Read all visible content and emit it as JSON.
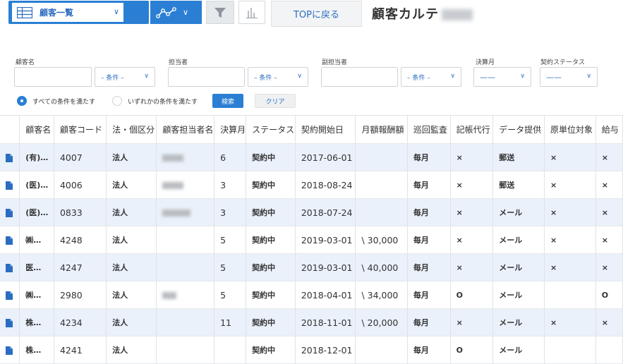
{
  "toolbar": {
    "view_label": "顧客一覧",
    "top_button": "TOPに戻る",
    "page_title": "顧客カルテ"
  },
  "filters": {
    "customer_name_label": "顧客名",
    "staff_label": "担当者",
    "sub_staff_label": "副担当者",
    "settlement_month_label": "決算月",
    "contract_status_label": "契約ステータス",
    "condition_label": "– 条件 –",
    "dash_value": "——",
    "radio_all": "すべての条件を満たす",
    "radio_any": "いずれかの条件を満たす",
    "search_button": "検索",
    "clear_button": "クリア"
  },
  "table": {
    "headers": [
      "",
      "顧客名",
      "顧客コード",
      "法・個区分",
      "顧客担当者名",
      "決算月",
      "ステータス",
      "契約開始日",
      "月額報酬額",
      "巡回監査",
      "記帳代行",
      "データ提供",
      "原単位対象",
      "給与"
    ],
    "rows": [
      {
        "name": "(有)…",
        "code": "4007",
        "type": "法人",
        "month": "6",
        "status": "契約中",
        "start": "2017-06-01",
        "fee": "",
        "audit": "毎月",
        "bookkeeping": "×",
        "data": "郵送",
        "unit": "×",
        "salary": "×"
      },
      {
        "name": "(医)…",
        "code": "4006",
        "type": "法人",
        "month": "3",
        "status": "契約中",
        "start": "2018-08-24",
        "fee": "",
        "audit": "毎月",
        "bookkeeping": "×",
        "data": "郵送",
        "unit": "×",
        "salary": "×"
      },
      {
        "name": "(医)…",
        "code": "0833",
        "type": "法人",
        "month": "3",
        "status": "契約中",
        "start": "2018-07-24",
        "fee": "",
        "audit": "毎月",
        "bookkeeping": "×",
        "data": "メール",
        "unit": "×",
        "salary": "×"
      },
      {
        "name": "㈱…",
        "code": "4248",
        "type": "法人",
        "month": "5",
        "status": "契約中",
        "start": "2019-03-01",
        "fee": "\\ 30,000",
        "audit": "毎月",
        "bookkeeping": "×",
        "data": "メール",
        "unit": "×",
        "salary": "×"
      },
      {
        "name": "医…",
        "code": "4247",
        "type": "法人",
        "month": "5",
        "status": "契約中",
        "start": "2019-03-01",
        "fee": "\\ 40,000",
        "audit": "毎月",
        "bookkeeping": "×",
        "data": "メール",
        "unit": "×",
        "salary": "×"
      },
      {
        "name": "㈱…",
        "code": "2980",
        "type": "法人",
        "month": "5",
        "status": "契約中",
        "start": "2018-04-01",
        "fee": "\\ 34,000",
        "audit": "毎月",
        "bookkeeping": "O",
        "data": "メール",
        "unit": "",
        "salary": "O"
      },
      {
        "name": "株…",
        "code": "4234",
        "type": "法人",
        "month": "11",
        "status": "契約中",
        "start": "2018-11-01",
        "fee": "\\ 20,000",
        "audit": "毎月",
        "bookkeeping": "×",
        "data": "メール",
        "unit": "×",
        "salary": "×"
      },
      {
        "name": "株…",
        "code": "4241",
        "type": "法人",
        "month": "",
        "status": "契約中",
        "start": "2018-12-01",
        "fee": "",
        "audit": "毎月",
        "bookkeeping": "O",
        "data": "メール",
        "unit": "",
        "salary": ""
      }
    ]
  },
  "colors": {
    "accent": "#2a7fd4",
    "row_alt": "#eaf1fa"
  }
}
